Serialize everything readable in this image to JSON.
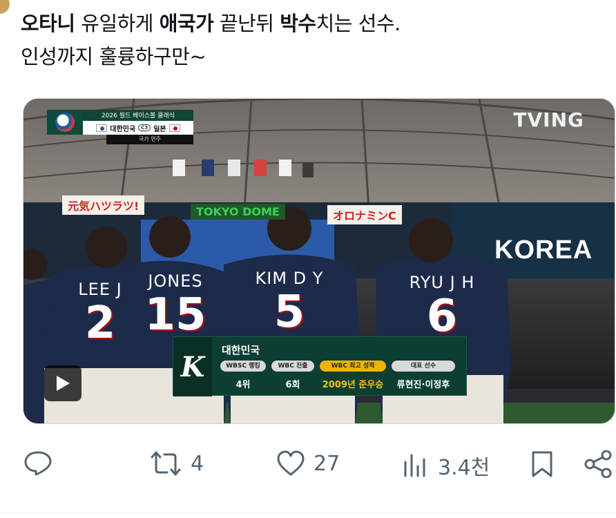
{
  "tweet": {
    "line1": {
      "p1": "오타니",
      "p2": " 유일하게 ",
      "p3": "애국가",
      "p4": " 끝난뒤 ",
      "p5": "박수",
      "p6": "치는 선수."
    },
    "line2": "인성까지 훌륭하구만~"
  },
  "video": {
    "scorebug": {
      "title": "2026 월드 베이스볼 클래식",
      "home": "대한민국",
      "vs": "C3",
      "away": "일본",
      "subtitle": "국가 연주"
    },
    "watermark": "TVING",
    "stadium": {
      "ad_left": "元気ハツラツ!",
      "ad_center": "TOKYO DOME",
      "ad_right": "オロナミンC",
      "board": "KOREA"
    },
    "players": [
      {
        "name": "LEE J",
        "number": "2"
      },
      {
        "name": "JONES",
        "number": "15"
      },
      {
        "name": "KIM D Y",
        "number": "5"
      },
      {
        "name": "RYU J H",
        "number": "6"
      }
    ],
    "info_panel": {
      "logo": "K",
      "team": "대한민국",
      "headers": [
        "WBSC 랭킹",
        "WBC 진출",
        "WBC 최고 성적",
        "대표 선수"
      ],
      "values": [
        "4위",
        "6회",
        "2009년 준우승",
        "류현진·이정후"
      ],
      "highlight_color": "#f0b400"
    },
    "play_icon": "play-icon"
  },
  "actions": {
    "reply": {
      "icon": "reply-icon",
      "count": ""
    },
    "retweet": {
      "icon": "retweet-icon",
      "count": "4"
    },
    "like": {
      "icon": "heart-icon",
      "count": "27"
    },
    "views": {
      "icon": "views-icon",
      "count": "3.4천"
    },
    "bookmark": {
      "icon": "bookmark-icon"
    },
    "share": {
      "icon": "share-icon"
    }
  },
  "colors": {
    "text": "#0f1419",
    "muted": "#536471",
    "panel_green": "#0c3e33"
  }
}
